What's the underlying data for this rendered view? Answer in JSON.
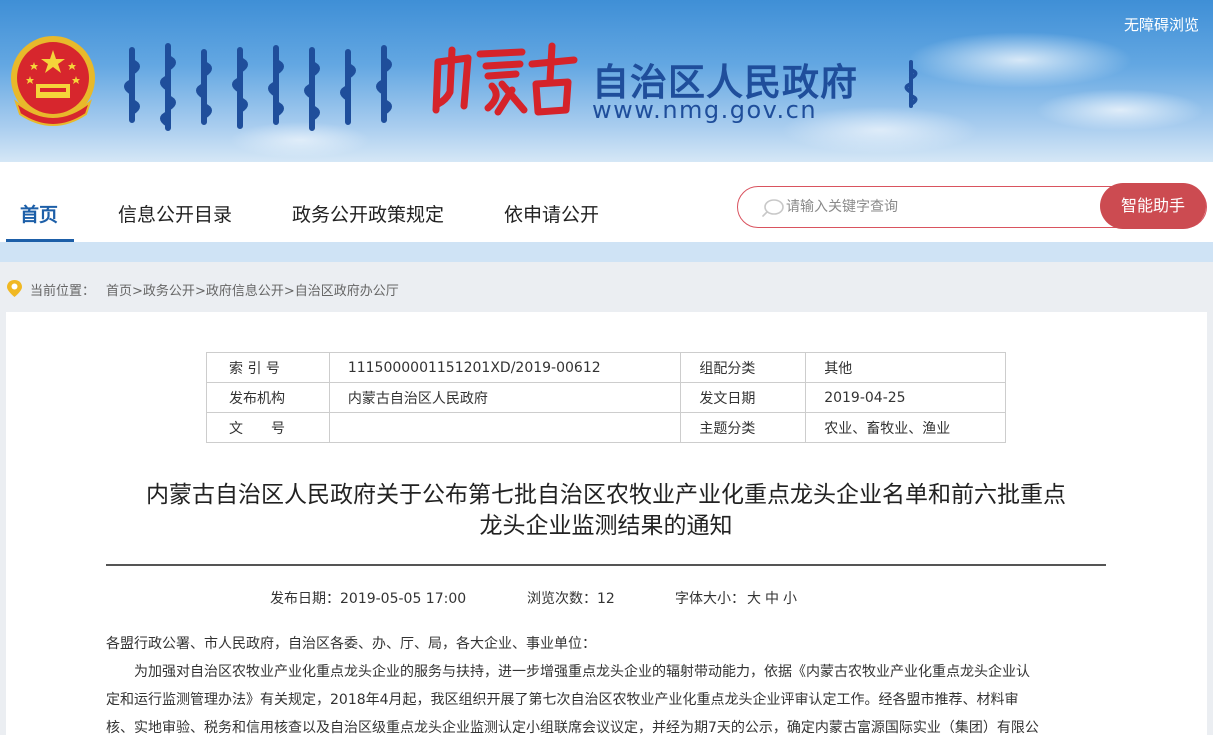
{
  "header": {
    "site_name": "自治区人民政府",
    "site_url": "www.nmg.gov.cn",
    "calligraphy_logo": "内蒙古",
    "accessibility_link": "无障碍浏览",
    "emblem": "national-emblem-icon"
  },
  "nav": {
    "items": [
      {
        "label": "首页",
        "active": true
      },
      {
        "label": "信息公开目录",
        "active": false
      },
      {
        "label": "政务公开政策规定",
        "active": false
      },
      {
        "label": "依申请公开",
        "active": false
      }
    ],
    "search_placeholder": "请输入关键字查询",
    "assistant_label": "智能助手",
    "accent_color": "#1d5fa8",
    "button_color": "#cc4b51"
  },
  "breadcrumb": {
    "label": "当前位置：",
    "items": [
      "首页",
      "政务公开",
      "政府信息公开",
      "自治区政府办公厅"
    ],
    "separator": ">"
  },
  "meta_table": {
    "rows": [
      {
        "k1": "索 引 号",
        "v1": "1115000001151201XD/2019-00612",
        "k2": "组配分类",
        "v2": "其他"
      },
      {
        "k1": "发布机构",
        "v1": "内蒙古自治区人民政府",
        "k2": "发文日期",
        "v2": "2019-04-25"
      },
      {
        "k1": "文　　号",
        "v1": "",
        "k2": "主题分类",
        "v2": "农业、畜牧业、渔业"
      }
    ]
  },
  "document": {
    "title_line1": "内蒙古自治区人民政府关于公布第七批自治区农牧业产业化重点龙头企业名单和前六批重点",
    "title_line2": "龙头企业监测结果的通知",
    "publish_label": "发布日期：",
    "publish_date": "2019-05-05 17:00",
    "views_label": "浏览次数：",
    "views": "12",
    "font_size_label": "字体大小：",
    "font_sizes": [
      "大",
      "中",
      "小"
    ],
    "salutation": "各盟行政公署、市人民政府，自治区各委、办、厅、局，各大企业、事业单位：",
    "para1_line1": "为加强对自治区农牧业产业化重点龙头企业的服务与扶持，进一步增强重点龙头企业的辐射带动能力，依据《内蒙古农牧业产业化重点龙头企业认",
    "para1_line2": "定和运行监测管理办法》有关规定，2018年4月起，我区组织开展了第七次自治区农牧业产业化重点龙头企业评审认定工作。经各盟市推荐、材料审",
    "para1_line3": "核、实地审验、税务和信用核查以及自治区级重点龙头企业监测认定小组联席会议议定，并经为期7天的公示，确定内蒙古富源国际实业（集团）有限公"
  }
}
